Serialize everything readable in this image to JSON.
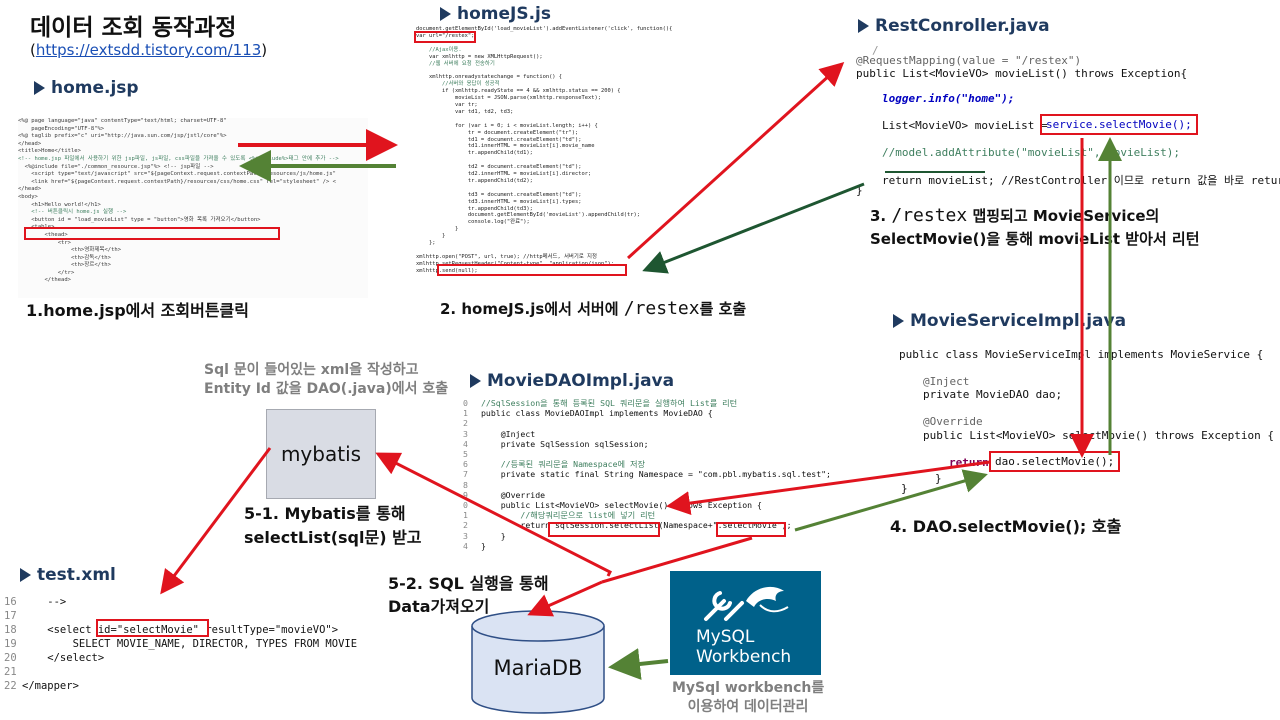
{
  "header": {
    "title": "데이터 조회 동작과정",
    "url_prefix": "(",
    "url": "https://extsdd.tistory.com/113",
    "url_suffix": ")"
  },
  "sections": {
    "home_jsp": "home.jsp",
    "homejs": "homeJS.js",
    "restcontroller": "RestConroller.java",
    "serviceimpl": "MovieServiceImpl.java",
    "daoimpl": "MovieDAOImpl.java",
    "testxml": "test.xml"
  },
  "steps": {
    "s1": "1.home.jsp에서 조회버튼클릭",
    "s2_pre": "2. homeJS.js에서 서버에 ",
    "s2_code": "/restex",
    "s2_post": "를 호출",
    "s3_num": "3. ",
    "s3_code": "/restex",
    "s3_post": " 맵핑되고  MovieService의",
    "s3_line2": "SelectMovie()을 통해 movieList 받아서 리턴",
    "s4": "4. DAO.selectMovie(); 호출",
    "s51_line1": "5-1. Mybatis를 통해",
    "s51_line2": "selectList(sql문) 받고",
    "s52_line1": "5-2. SQL 실행을 통해",
    "s52_line2": "Data가져오기"
  },
  "notes": {
    "mybatis_line1": "Sql 문이 들어있는 xml을 작성하고",
    "mybatis_line2": "Entity Id 값을 DAO(.java)에서 호출",
    "workbench_line1": "MySql workbench를",
    "workbench_line2": "이용하여 데이터관리"
  },
  "boxes": {
    "mybatis": "mybatis",
    "mariadb": "MariaDB",
    "workbench_line1": "MySQL",
    "workbench_line2": "Workbench"
  },
  "code": {
    "home_jsp": [
      "<%@ page language=\"java\" contentType=\"text/html; charset=UTF-8\"",
      "    pageEncoding=\"UTF-8\"%>",
      "<%@ taglib prefix=\"c\" uri=\"http://java.sun.com/jsp/jstl/core\"%>",
      "</head>",
      "<title>Home</title>",
      "<!-- home.jsp 파일에서 사용하기 위한 jsp파일, js파일, css파일을 가져올 수 있도록 <%@include%>태그 안에 추가 -->",
      "  <%@include file=\"./common_resource.jsp\"%> <!-- jsp파일 -->",
      "    <script type=\"text/javascript\" src=\"${pageContext.request.contextPath}/resources/js/home.js\"",
      "    <link href=\"${pageContext.request.contextPath}/resources/css/home.css\" rel=\"stylesheet\" /> <",
      "</head>",
      "<body>",
      "    <h1>Hello world!</h1>",
      "    <!-- 버튼클릭시 home.js 실행 -->",
      "    <button id = \"load_movieList\" type = \"button\">영화 목록 가져오기</button>",
      "    <table>",
      "        <thead>",
      "            <tr>",
      "                <th>영화제목</th>",
      "                <th>감독</th>",
      "                <th>장르</th>",
      "            </tr>",
      "        </thead>"
    ],
    "homejs": [
      "document.getElementById('load_movieList').addEventListener('click', function(){",
      "var url=\"/restex\";",
      "",
      "    //Ajax이용.",
      "    var xmlhttp = new XMLHttpRequest();",
      "    //웹 서버에 요청 전송하기",
      "",
      "    xmlhttp.onreadystatechange = function() {",
      "        //서버와 응답이 성공적",
      "        if (xmlhttp.readyState == 4 && xmlhttp.status == 200) {",
      "            movieList = JSON.parse(xmlhttp.responseText);",
      "            var tr;",
      "            var td1, td2, td3;",
      "",
      "            for (var i = 0; i < movieList.length; i++) {",
      "                tr = document.createElement(\"tr\");",
      "                td1 = document.createElement(\"td\");",
      "                td1.innerHTML = movieList[i].movie_name",
      "                tr.appendChild(td1);",
      "",
      "                td2 = document.createElement(\"td\");",
      "                td2.innerHTML = movieList[i].director;",
      "                tr.appendChild(td2);",
      "",
      "                td3 = document.createElement(\"td\");",
      "                td3.innerHTML = movieList[i].types;",
      "                tr.appendChild(td3);",
      "                document.getElementById('movieList').appendChild(tr);",
      "                console.log(\"완료\");",
      "            }",
      "        }",
      "    };",
      "",
      "xmlhttp.open(\"POST\", url, true); //http메서드, 서버기로 지정",
      "xmlhttp.setRequestHeader(\"Content-type\", \"application/json\");",
      "xmlhttp.send(null);"
    ],
    "rest": {
      "mapping": "@RequestMapping(value = \"/restex\")",
      "sig": "public List<MovieVO> movieList() throws Exception{",
      "logger": "logger.info(\"home\");",
      "list_decl": "List<MovieVO> movieList = ",
      "service_call": "service.selectMovie();",
      "comment": "//model.addAttribute(\"movieList\", movieList);",
      "ret": "return movieList; //RestController 이므로 return 값을 바로 return",
      "close": "}"
    },
    "service": {
      "cls": "public class MovieServiceImpl implements MovieService {",
      "inject": "@Inject",
      "field": "private MovieDAO dao;",
      "override": "@Override",
      "sig": "public List<MovieVO> selectMovie() throws Exception {",
      "ret_kw": "return ",
      "dao_call": "dao.selectMovie();",
      "close1": "}",
      "close2": "}"
    },
    "dao": [
      {
        "n": "0",
        "t": "//SqlSession을 통해 등록된 SQL 쿼리문을 실행하여 List를 리턴"
      },
      {
        "n": "1",
        "t": "public class MovieDAOImpl implements MovieDAO {"
      },
      {
        "n": "2",
        "t": ""
      },
      {
        "n": "3",
        "t": "    @Inject"
      },
      {
        "n": "4",
        "t": "    private SqlSession sqlSession;"
      },
      {
        "n": "5",
        "t": ""
      },
      {
        "n": "6",
        "t": "    //등록된 쿼리문을 Namespace에 저장"
      },
      {
        "n": "7",
        "t": "    private static final String Namespace = \"com.pbl.mybatis.sql.test\";"
      },
      {
        "n": "8",
        "t": ""
      },
      {
        "n": "9",
        "t": "    @Override"
      },
      {
        "n": "0",
        "t": "    public List<MovieVO> selectMovie() throws Exception {"
      },
      {
        "n": "1",
        "t": "        //해당쿼리문으로 list에 넣기 리턴"
      },
      {
        "n": "2",
        "t": "        return sqlSession.selectList(Namespace+\".selectMovie\");"
      },
      {
        "n": "3",
        "t": "    }"
      },
      {
        "n": "4",
        "t": "}"
      }
    ],
    "xml": [
      {
        "n": "16",
        "t": "    -->"
      },
      {
        "n": "17",
        "t": ""
      },
      {
        "n": "18",
        "t": "    <select id=\"selectMovie\" resultType=\"movieVO\">"
      },
      {
        "n": "19",
        "t": "        SELECT MOVIE_NAME, DIRECTOR, TYPES FROM MOVIE"
      },
      {
        "n": "20",
        "t": "    </select>"
      },
      {
        "n": "21",
        "t": ""
      },
      {
        "n": "22",
        "t": "</mapper>"
      }
    ]
  },
  "colors": {
    "arrow_red": "#e0141e",
    "arrow_green": "#548235",
    "arrow_darkgreen": "#1e5631",
    "section_title": "#1f3a5f",
    "mybatis_box": "#d9dce4",
    "mysql_tile": "#00618a"
  }
}
